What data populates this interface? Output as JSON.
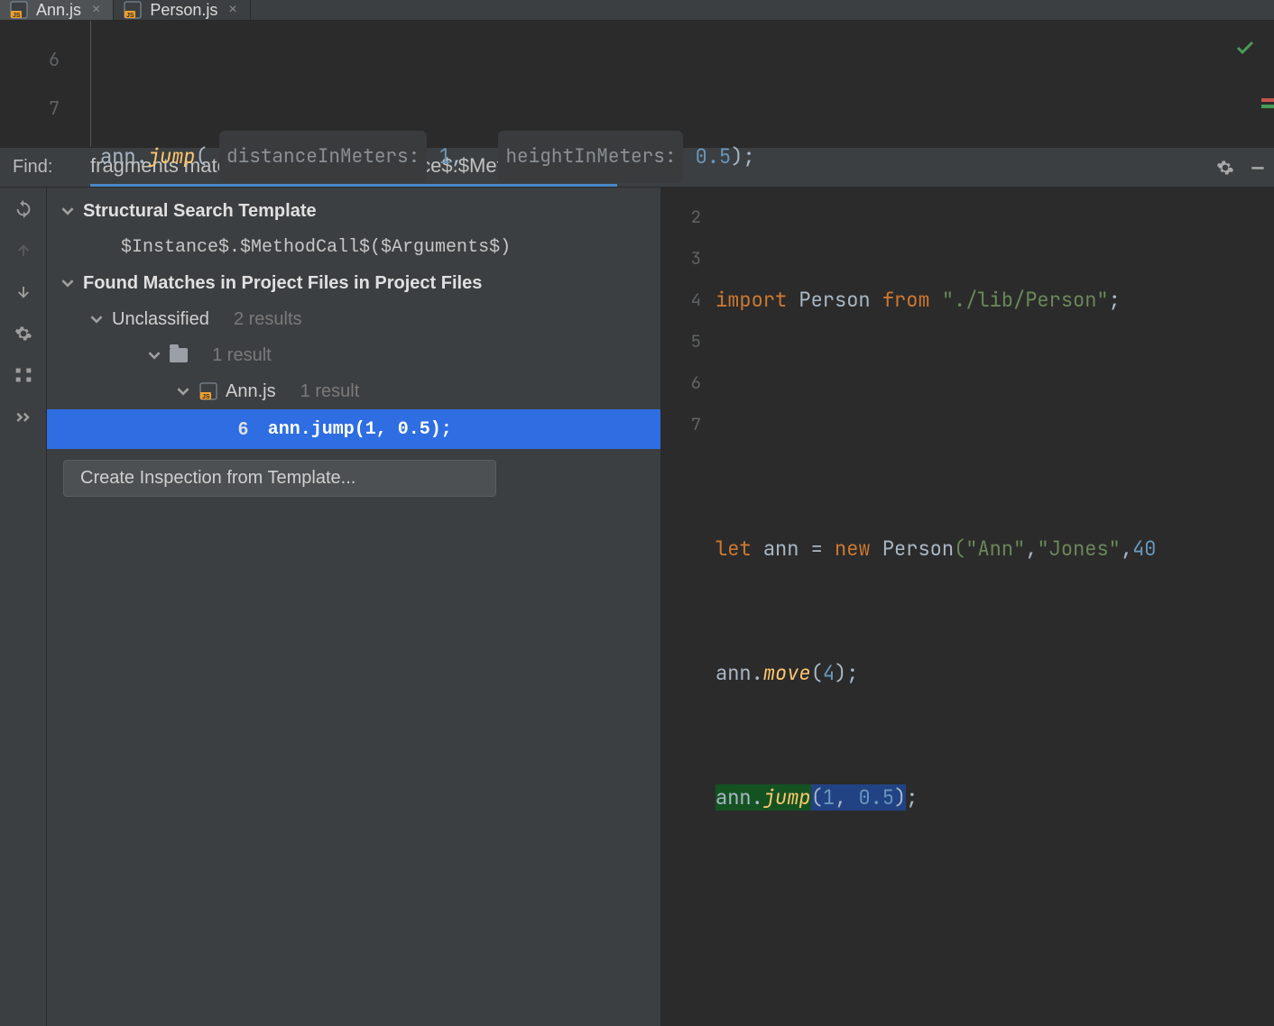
{
  "tabs": [
    {
      "file": "Ann.js",
      "active": true
    },
    {
      "file": "Person.js",
      "active": false
    }
  ],
  "editor_top": {
    "lines": [
      "6",
      "7"
    ],
    "row": {
      "ident": "ann",
      "method": "jump",
      "hint1": "distanceInMeters:",
      "arg1": "1",
      "hint2": "heightInMeters:",
      "arg2": "0.5"
    }
  },
  "find": {
    "label": "Find:",
    "query": "fragments matching template '$Instance$.$MethodCa...",
    "template_heading": "Structural Search Template",
    "template": "$Instance$.$MethodCall$($Arguments$)",
    "found_heading": "Found Matches in Project Files in Project Files",
    "unclassified_label": "Unclassified",
    "unclassified_count": "2 results",
    "folder_count": "1 result",
    "file_name": "Ann.js",
    "file_count": "1 result",
    "match_line": "6",
    "match_text": "ann.jump(1, 0.5);",
    "inspection_button": "Create Inspection from Template..."
  },
  "preview": {
    "lines": [
      "2",
      "3",
      "4",
      "5",
      "6",
      "7"
    ],
    "l2": {
      "kw": "import",
      "id": "Person",
      "from": "from",
      "str": "\"./lib/Person\""
    },
    "l4": {
      "kw": "let",
      "id": "ann",
      "eq": "=",
      "new": "new",
      "ctor": "Person",
      "args": "(\"Ann\",\"Jones\",40"
    },
    "l5": {
      "id": "ann",
      "method": "move",
      "args": "(4);"
    },
    "l6": {
      "id": "ann",
      "method": "jump",
      "open": "(",
      "a1": "1",
      "comma": ", ",
      "a2": "0.5",
      "close": ")",
      "semi": ";"
    }
  }
}
